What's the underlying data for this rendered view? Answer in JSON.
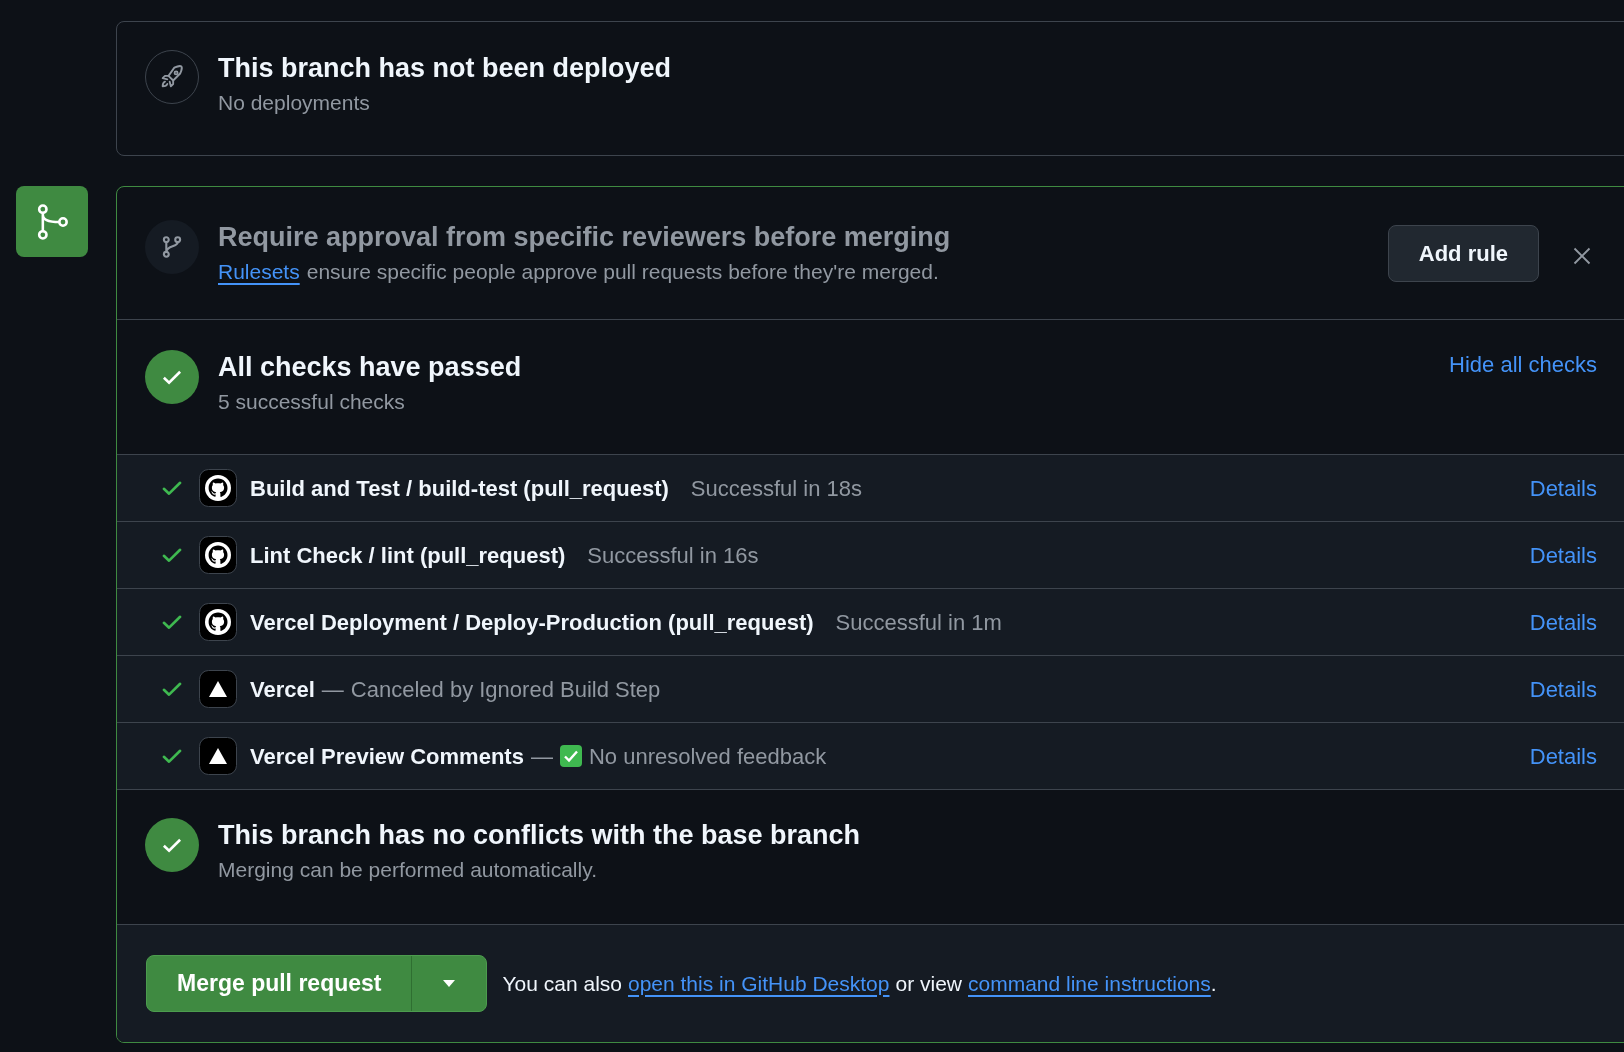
{
  "deployment": {
    "title": "This branch has not been deployed",
    "subtitle": "No deployments"
  },
  "ruleset_prompt": {
    "title": "Require approval from specific reviewers before merging",
    "link": "Rulesets",
    "text": "ensure specific people approve pull requests before they're merged.",
    "button": "Add rule"
  },
  "checks_summary": {
    "title": "All checks have passed",
    "subtitle": "5 successful checks",
    "toggle": "Hide all checks"
  },
  "checks": [
    {
      "kind": "github",
      "name": "Build and Test / build-test (pull_request)",
      "status": "Successful in 18s",
      "link": "Details"
    },
    {
      "kind": "github",
      "name": "Lint Check / lint (pull_request)",
      "status": "Successful in 16s",
      "link": "Details"
    },
    {
      "kind": "github",
      "name": "Vercel Deployment / Deploy-Production (pull_request)",
      "status": "Successful in 1m",
      "link": "Details"
    },
    {
      "kind": "vercel",
      "name": "Vercel",
      "separator": "—",
      "status": "Canceled by Ignored Build Step",
      "link": "Details"
    },
    {
      "kind": "vercel",
      "name": "Vercel Preview Comments",
      "separator": "—",
      "status_check": true,
      "status": "No unresolved feedback",
      "link": "Details"
    }
  ],
  "conflicts": {
    "title": "This branch has no conflicts with the base branch",
    "subtitle": "Merging can be performed automatically."
  },
  "merge": {
    "button": "Merge pull request",
    "text_before": "You can also",
    "link_desktop": "open this in GitHub Desktop",
    "text_middle": "or view",
    "link_cli": "command line instructions",
    "text_after": "."
  }
}
